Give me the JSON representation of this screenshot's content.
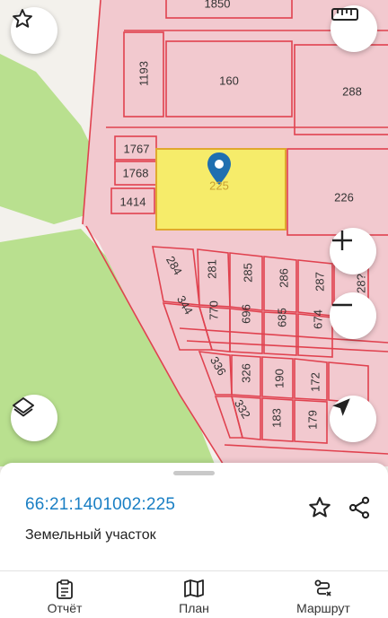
{
  "map": {
    "plots": [
      {
        "id": "p1850",
        "label": "1850"
      },
      {
        "id": "p1193",
        "label": "1193"
      },
      {
        "id": "p160",
        "label": "160"
      },
      {
        "id": "p288",
        "label": "288"
      },
      {
        "id": "p1767",
        "label": "1767"
      },
      {
        "id": "p1768",
        "label": "1768"
      },
      {
        "id": "p1414",
        "label": "1414"
      },
      {
        "id": "p225",
        "label": "225"
      },
      {
        "id": "p226",
        "label": "226"
      },
      {
        "id": "p284",
        "label": "284"
      },
      {
        "id": "p281",
        "label": "281"
      },
      {
        "id": "p285",
        "label": "285"
      },
      {
        "id": "p286",
        "label": "286"
      },
      {
        "id": "p287",
        "label": "287"
      },
      {
        "id": "p282",
        "label": "28?"
      },
      {
        "id": "p344",
        "label": "344"
      },
      {
        "id": "p770",
        "label": "770"
      },
      {
        "id": "p696",
        "label": "696"
      },
      {
        "id": "p685",
        "label": "685"
      },
      {
        "id": "p674",
        "label": "674"
      },
      {
        "id": "p336",
        "label": "336"
      },
      {
        "id": "p326",
        "label": "326"
      },
      {
        "id": "p190",
        "label": "190"
      },
      {
        "id": "p172",
        "label": "172"
      },
      {
        "id": "p332",
        "label": "332"
      },
      {
        "id": "p183",
        "label": "183"
      },
      {
        "id": "p179",
        "label": "179"
      }
    ],
    "colors": {
      "plot_fill": "#f2c9cf",
      "plot_border": "#e0424f",
      "selected": "#f6ec6a",
      "green": "#b8e08e",
      "pin": "#1f6fb0"
    }
  },
  "buttons": {
    "favorite": "star-icon",
    "ruler": "ruler-icon",
    "zoom_in": "plus-icon",
    "zoom_out": "minus-icon",
    "layers": "layers-icon",
    "locate": "navigation-arrow-icon"
  },
  "sheet": {
    "cadastral_number": "66:21:1401002:225",
    "object_type": "Земельный участок"
  },
  "tabs": [
    {
      "label": "Отчёт",
      "icon": "clipboard-icon"
    },
    {
      "label": "План",
      "icon": "map-icon"
    },
    {
      "label": "Маршрут",
      "icon": "route-icon"
    }
  ]
}
